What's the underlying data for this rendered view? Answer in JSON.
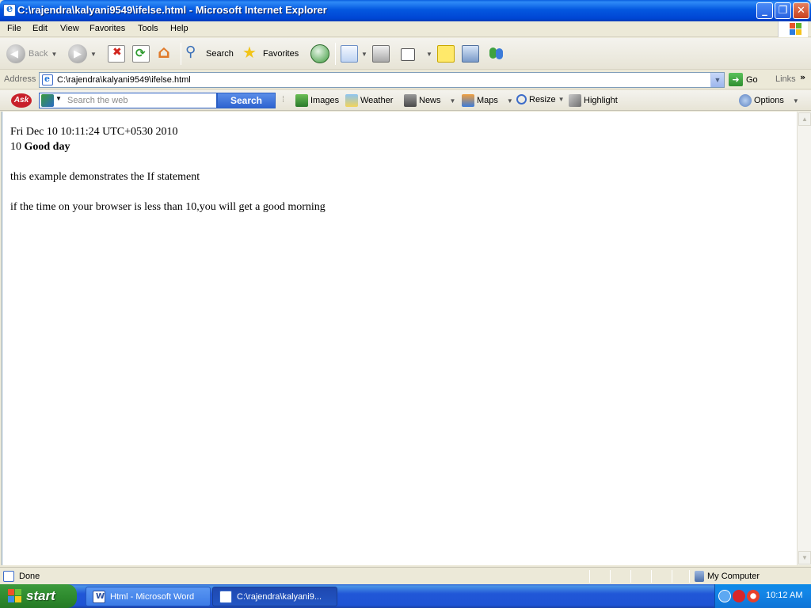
{
  "window": {
    "title": "C:\\rajendra\\kalyani9549\\ifelse.html - Microsoft Internet Explorer",
    "minimize_glyph": "_",
    "restore_glyph": "❐",
    "close_glyph": "✕"
  },
  "menu": [
    "File",
    "Edit",
    "View",
    "Favorites",
    "Tools",
    "Help"
  ],
  "toolbar": {
    "back": "Back",
    "search": "Search",
    "favorites": "Favorites"
  },
  "address": {
    "label": "Address",
    "value": "C:\\rajendra\\kalyani9549\\ifelse.html",
    "go": "Go",
    "links": "Links",
    "more": "»"
  },
  "ask": {
    "logo": "Ask",
    "placeholder": "Search the web",
    "search_button": "Search",
    "items": [
      "Images",
      "Weather",
      "News",
      "Maps",
      "Resize",
      "Highlight",
      "Options"
    ]
  },
  "page": {
    "datetime": "Fri Dec 10 10:11:24 UTC+0530 2010",
    "hour_value": "10",
    "greeting": "Good day",
    "line1": "this example demonstrates the If statement",
    "line2": "if the time on your browser is less than 10,you will get a good morning"
  },
  "status": {
    "text": "Done",
    "zone": "My Computer"
  },
  "taskbar": {
    "start": "start",
    "tasks": [
      "Html - Microsoft Word",
      "C:\\rajendra\\kalyani9..."
    ],
    "clock": "10:12 AM"
  },
  "colors": {
    "titlebar": "#0054E3",
    "start_green": "#2F8C2F",
    "taskbar_blue": "#2157D7",
    "tray_blue": "#1387E8"
  }
}
